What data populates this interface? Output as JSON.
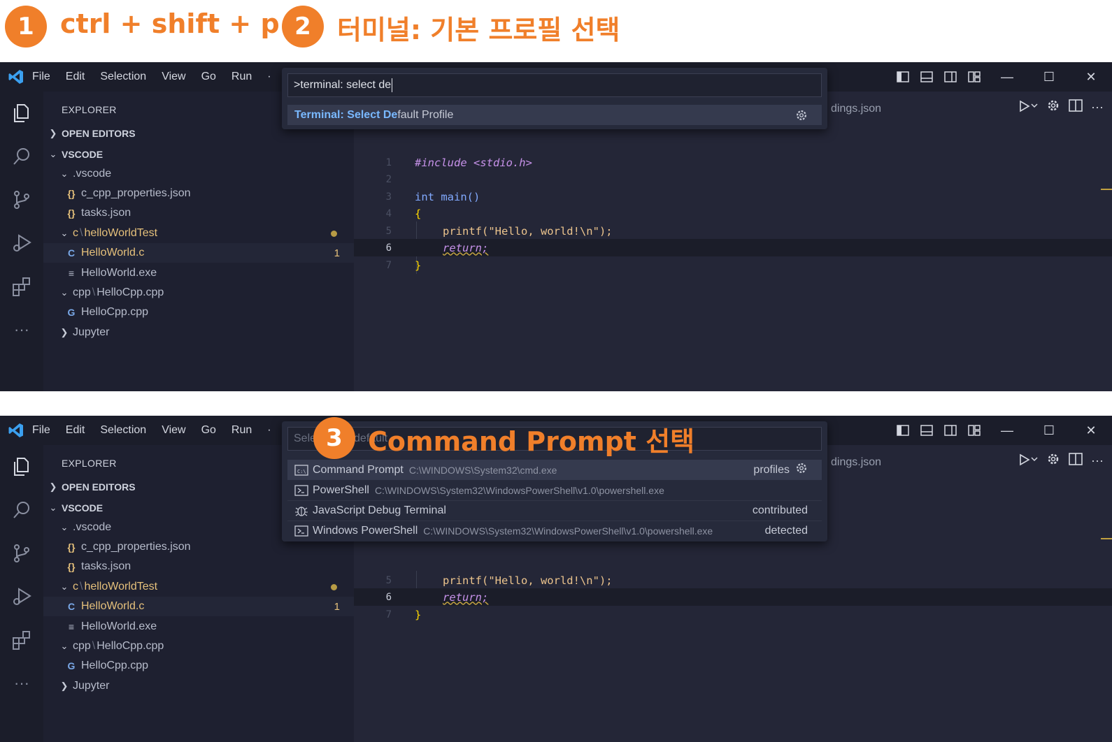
{
  "steps": [
    {
      "number": "1",
      "text": "ctrl  +  shift  +  p"
    },
    {
      "number": "2",
      "text": "터미널: 기본 프로필 선택"
    },
    {
      "number": "3",
      "text": "Command Prompt 선택"
    }
  ],
  "menu": [
    "File",
    "Edit",
    "Selection",
    "View",
    "Go",
    "Run",
    "·"
  ],
  "explorer": {
    "title": "EXPLORER",
    "open_editors": "OPEN EDITORS",
    "root": "VSCODE",
    "items": [
      {
        "label": ".vscode"
      },
      {
        "label": "c_cpp_properties.json",
        "icon": "{}"
      },
      {
        "label": "tasks.json",
        "icon": "{}"
      },
      {
        "prefix": "c",
        "label": "helloWorldTest"
      },
      {
        "label": "HelloWorld.c",
        "icon": "C",
        "badge": "1"
      },
      {
        "label": "HelloWorld.exe",
        "icon": "≡"
      },
      {
        "prefix": "cpp",
        "label": "HelloCpp.cpp"
      },
      {
        "label": "HelloCpp.cpp",
        "icon": "G"
      },
      {
        "label": "Jupyter"
      }
    ]
  },
  "editor": {
    "tab_fragment": "dings.json",
    "lines": [
      {
        "n": "1",
        "code": "#include <stdio.h>"
      },
      {
        "n": "2",
        "code": ""
      },
      {
        "n": "3",
        "code": "int main()"
      },
      {
        "n": "4",
        "code": "{"
      },
      {
        "n": "5",
        "code": "printf(\"Hello, world!\\n\");"
      },
      {
        "n": "6",
        "code": "return;"
      },
      {
        "n": "7",
        "code": "}"
      }
    ]
  },
  "palette1": {
    "input": ">terminal: select de",
    "result_bold": "Terminal: Select De",
    "result_rest": "fault Profile"
  },
  "palette2": {
    "input_fragment": "Sele",
    "input_fragment2": "default",
    "items": [
      {
        "label": "Command Prompt",
        "path": "C:\\WINDOWS\\System32\\cmd.exe",
        "tag": "profiles"
      },
      {
        "label": "PowerShell",
        "path": "C:\\WINDOWS\\System32\\WindowsPowerShell\\v1.0\\powershell.exe",
        "tag": ""
      },
      {
        "label": "JavaScript Debug Terminal",
        "path": "",
        "tag": "contributed"
      },
      {
        "label": "Windows PowerShell",
        "path": "C:\\WINDOWS\\System32\\WindowsPowerShell\\v1.0\\powershell.exe",
        "tag": "detected"
      }
    ]
  },
  "colors": {
    "accent": "#f07f2a",
    "vscode_blue": "#3ba0f0",
    "folder_yellow": "#e5c07b"
  }
}
